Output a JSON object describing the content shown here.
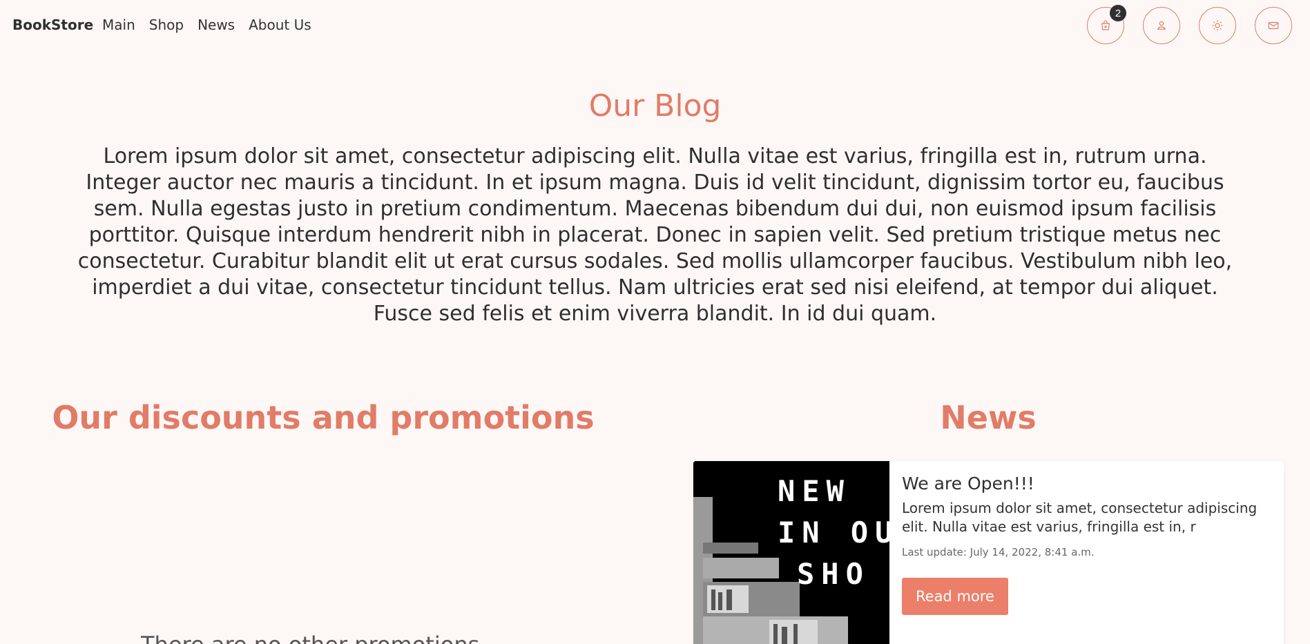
{
  "nav": {
    "brand": "BookStore",
    "links": [
      {
        "label": "Main"
      },
      {
        "label": "Shop"
      },
      {
        "label": "News"
      },
      {
        "label": "About Us"
      }
    ],
    "cart_count": "2",
    "icons": [
      "cart-icon",
      "user-icon",
      "theme-sun-icon",
      "mail-icon"
    ]
  },
  "blog": {
    "title": "Our Blog",
    "text": "Lorem ipsum dolor sit amet, consectetur adipiscing elit. Nulla vitae est varius, fringilla est in, rutrum urna. Integer auctor nec mauris a tincidunt. In et ipsum magna. Duis id velit tincidunt, dignissim tortor eu, faucibus sem. Nulla egestas justo in pretium condimentum. Maecenas bibendum dui dui, non euismod ipsum facilisis porttitor. Quisque interdum hendrerit nibh in placerat. Donec in sapien velit. Sed pretium tristique metus nec consectetur. Curabitur blandit elit ut erat cursus sodales. Sed mollis ullamcorper faucibus. Vestibulum nibh leo, imperdiet a dui vitae, consectetur tincidunt tellus. Nam ultricies erat sed nisi eleifend, at tempor dui aliquet. Fusce sed felis et enim viverra blandit. In id dui quam."
  },
  "promotions": {
    "title": "Our discounts and promotions",
    "partial_text": "There are no other promotions"
  },
  "news": {
    "title": "News",
    "card": {
      "image_text": [
        "NEW",
        "IN OU",
        "SHO"
      ],
      "title": "We are Open!!!",
      "text": "Lorem ipsum dolor sit amet, consectetur adipiscing elit. Nulla vitae est varius, fringilla est in, r",
      "date": "Last update: July 14, 2022, 8:41 a.m.",
      "button": "Read more"
    }
  },
  "colors": {
    "accent": "#e27b67",
    "button": "#ec7f69",
    "background": "#fdf8f6"
  }
}
